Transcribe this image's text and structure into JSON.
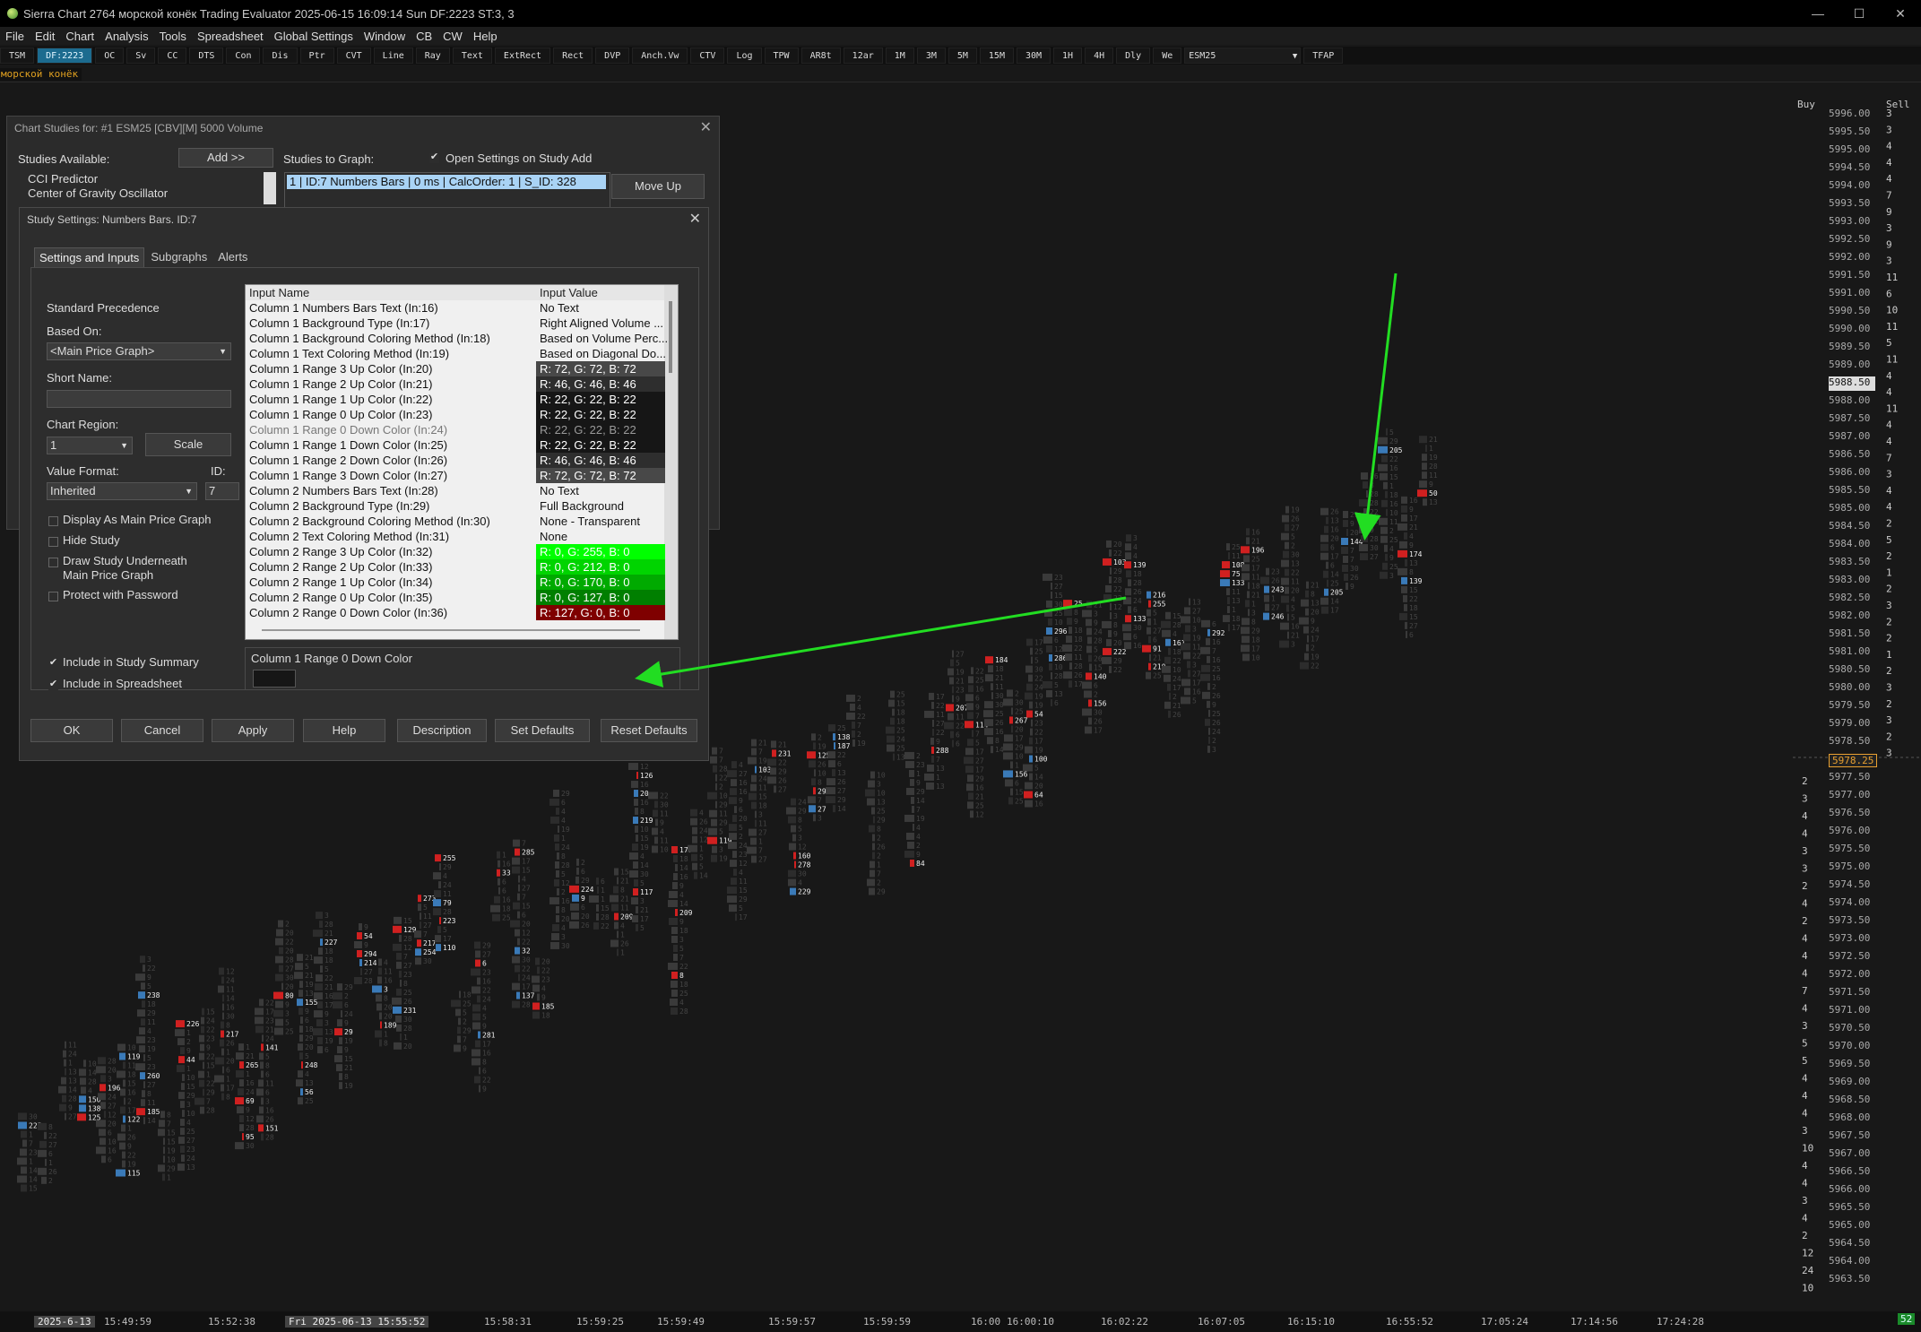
{
  "window": {
    "title": "Sierra Chart 2764 морской конёк Trading Evaluator 2025-06-15  16:09:14 Sun DF:2223  ST:3, 3",
    "controls": [
      "—",
      "☐",
      "✕"
    ]
  },
  "menu": [
    "File",
    "Edit",
    "Chart",
    "Analysis",
    "Tools",
    "Spreadsheet",
    "Global Settings",
    "Window",
    "CB",
    "CW",
    "Help"
  ],
  "toolbar": {
    "buttons": [
      "TSM",
      "DF:2223",
      "OC",
      "Sv",
      "CC",
      "DTS",
      "Con",
      "Dis",
      "Ptr",
      "CVT",
      "Line",
      "Ray",
      "Text",
      "ExtRect",
      "Rect",
      "DVP",
      "Anch.Vw",
      "CTV",
      "Log",
      "TPW",
      "AR8t",
      "12ar",
      "1M",
      "3M",
      "5M",
      "15M",
      "30M",
      "1H",
      "4H",
      "Dly",
      "We"
    ],
    "active_index": 1,
    "symbol": "ESM25",
    "after_symbol": "TFAP"
  },
  "chart_name": "морской конёк",
  "price_axis": {
    "header_buy": "Buy",
    "header_sell": "Sell",
    "prices": [
      "5996.00",
      "5995.50",
      "5995.00",
      "5994.50",
      "5994.00",
      "5993.50",
      "5993.00",
      "5992.50",
      "5992.00",
      "5991.50",
      "5991.00",
      "5990.50",
      "5990.00",
      "5989.50",
      "5989.00",
      "5988.50",
      "5988.00",
      "5987.50",
      "5987.00",
      "5986.50",
      "5986.00",
      "5985.50",
      "5985.00",
      "5984.50",
      "5984.00",
      "5983.50",
      "5983.00",
      "5982.50",
      "5982.00",
      "5981.50",
      "5981.00",
      "5980.50",
      "5980.00",
      "5979.50",
      "5979.00",
      "5978.50",
      "5978.00",
      "5977.50",
      "5977.00",
      "5976.50",
      "5976.00",
      "5975.50",
      "5975.00",
      "5974.50",
      "5974.00",
      "5973.50",
      "5973.00",
      "5972.50",
      "5972.00",
      "5971.50",
      "5971.00",
      "5970.50",
      "5970.00",
      "5969.50",
      "5969.00",
      "5968.50",
      "5968.00",
      "5967.50",
      "5967.00",
      "5966.50",
      "5966.00",
      "5965.50",
      "5965.00",
      "5964.50",
      "5964.00",
      "5963.50"
    ],
    "highlight_price": "5988.50",
    "current_price": "5978.25",
    "sell_column": [
      "3",
      "3",
      "4",
      "4",
      "4",
      "7",
      "9",
      "3",
      "9",
      "3",
      "11",
      "6",
      "10",
      "11",
      "5",
      "11",
      "4",
      "4",
      "11",
      "4",
      "4",
      "7",
      "3",
      "4",
      "4",
      "2",
      "5",
      "2",
      "1",
      "2",
      "3",
      "2",
      "2",
      "1",
      "2",
      "3",
      "2",
      "3",
      "2",
      "3"
    ],
    "buy_column": [
      "2",
      "3",
      "4",
      "4",
      "3",
      "3",
      "2",
      "4",
      "2",
      "4",
      "4",
      "4",
      "7",
      "4",
      "3",
      "5",
      "5",
      "4",
      "4",
      "4",
      "3",
      "10",
      "4",
      "4",
      "3",
      "4",
      "2",
      "12",
      "24",
      "10"
    ],
    "bottom_badge": "52"
  },
  "time_axis": {
    "labels": [
      "2025-6-13",
      "15:49:59",
      "15:52:38",
      "Fri 2025-06-13  15:55:52",
      "15:58:31",
      "15:59:25",
      "15:59:49",
      "15:59:57",
      "15:59:59",
      "16:00",
      "16:00:10",
      "16:02:22",
      "16:07:05",
      "16:15:10",
      "16:55:52",
      "17:05:24",
      "17:14:56",
      "17:24:28"
    ]
  },
  "chart_studies_dialog": {
    "title": "Chart Studies for: #1 ESM25 [CBV][M]  5000 Volume",
    "studies_available_label": "Studies Available:",
    "add_button": "Add >>",
    "studies_available": [
      "CCI Predictor",
      "Center of Gravity Oscillator"
    ],
    "studies_to_graph_label": "Studies to Graph:",
    "open_settings_checkbox": "Open Settings on Study Add",
    "selected_study": "1 | ID:7  Numbers Bars | 0 ms | CalcOrder: 1 | S_ID: 328",
    "move_up_button": "Move Up"
  },
  "study_settings_dialog": {
    "title": "Study Settings: Numbers Bars. ID:7",
    "tabs": [
      "Settings and Inputs",
      "Subgraphs",
      "Alerts"
    ],
    "standard_precedence": "Standard Precedence",
    "based_on_label": "Based On:",
    "based_on_value": "<Main Price Graph>",
    "short_name_label": "Short Name:",
    "short_name_value": "",
    "chart_region_label": "Chart Region:",
    "chart_region_value": "1",
    "scale_button": "Scale",
    "value_format_label": "Value Format:",
    "value_format_value": "Inherited",
    "id_label": "ID:",
    "id_value": "7",
    "checkboxes": [
      {
        "label": "Display As Main Price Graph",
        "checked": false
      },
      {
        "label": "Hide Study",
        "checked": false
      },
      {
        "label": "Draw Study Underneath",
        "label2": "Main Price Graph",
        "checked": false
      },
      {
        "label": "Protect with Password",
        "checked": false
      }
    ],
    "summary_checkboxes": [
      {
        "label": "Include in Study Summary",
        "checked": true
      },
      {
        "label": "Include in Spreadsheet",
        "checked": true
      }
    ],
    "grid_headers": [
      "Input Name",
      "Input Value"
    ],
    "inputs": [
      {
        "name": "Column 1 Numbers Bars Text  (In:16)",
        "value": "No Text",
        "bg": "",
        "fg": "#111"
      },
      {
        "name": "Column 1 Background Type  (In:17)",
        "value": "Right Aligned Volume ...",
        "bg": "",
        "fg": "#111"
      },
      {
        "name": "Column 1 Background Coloring Method  (In:18)",
        "value": "Based on Volume Perc...",
        "bg": "",
        "fg": "#111"
      },
      {
        "name": "Column 1 Text Coloring Method  (In:19)",
        "value": "Based on Diagonal Do...",
        "bg": "",
        "fg": "#111"
      },
      {
        "name": "Column 1 Range 3 Up Color  (In:20)",
        "value": "R: 72, G: 72, B: 72",
        "bg": "#484848",
        "fg": "#ffffff"
      },
      {
        "name": "Column 1 Range 2 Up Color  (In:21)",
        "value": "R: 46, G: 46, B: 46",
        "bg": "#2e2e2e",
        "fg": "#ffffff"
      },
      {
        "name": "Column 1 Range 1 Up Color  (In:22)",
        "value": "R: 22, G: 22, B: 22",
        "bg": "#161616",
        "fg": "#ffffff"
      },
      {
        "name": "Column 1 Range 0 Up Color  (In:23)",
        "value": "R: 22, G: 22, B: 22",
        "bg": "#161616",
        "fg": "#ffffff"
      },
      {
        "name": "Column 1 Range 0 Down Color  (In:24)",
        "value": "R: 22, G: 22, B: 22",
        "bg": "#161616",
        "fg": "#9a9a9a",
        "selected": true
      },
      {
        "name": "Column 1 Range 1 Down Color  (In:25)",
        "value": "R: 22, G: 22, B: 22",
        "bg": "#161616",
        "fg": "#ffffff"
      },
      {
        "name": "Column 1 Range 2 Down Color  (In:26)",
        "value": "R: 46, G: 46, B: 46",
        "bg": "#2e2e2e",
        "fg": "#ffffff"
      },
      {
        "name": "Column 1 Range 3 Down Color  (In:27)",
        "value": "R: 72, G: 72, B: 72",
        "bg": "#484848",
        "fg": "#ffffff"
      },
      {
        "name": "Column 2 Numbers Bars Text  (In:28)",
        "value": "No Text",
        "bg": "",
        "fg": "#111"
      },
      {
        "name": "Column 2 Background Type  (In:29)",
        "value": "Full Background",
        "bg": "",
        "fg": "#111"
      },
      {
        "name": "Column 2 Background Coloring Method  (In:30)",
        "value": "None - Transparent",
        "bg": "",
        "fg": "#111"
      },
      {
        "name": "Column 2 Text Coloring Method  (In:31)",
        "value": "None",
        "bg": "",
        "fg": "#111"
      },
      {
        "name": "Column 2 Range 3 Up Color  (In:32)",
        "value": "R: 0, G: 255, B: 0",
        "bg": "#00ff00",
        "fg": "#ffffff"
      },
      {
        "name": "Column 2 Range 2 Up Color  (In:33)",
        "value": "R: 0, G: 212, B: 0",
        "bg": "#00d400",
        "fg": "#ffffff"
      },
      {
        "name": "Column 2 Range 1 Up Color  (In:34)",
        "value": "R: 0, G: 170, B: 0",
        "bg": "#00aa00",
        "fg": "#ffffff"
      },
      {
        "name": "Column 2 Range 0 Up Color  (In:35)",
        "value": "R: 0, G: 127, B: 0",
        "bg": "#007f00",
        "fg": "#ffffff"
      },
      {
        "name": "Column 2 Range 0 Down Color  (In:36)",
        "value": "R: 127, G: 0, B: 0",
        "bg": "#7f0000",
        "fg": "#ffffff"
      }
    ],
    "selected_input_label": "Column 1 Range 0 Down Color",
    "selected_input_swatch": "#161616",
    "buttons": [
      "OK",
      "Cancel",
      "Apply",
      "Help",
      "Description",
      "Set Defaults",
      "Reset Defaults"
    ]
  },
  "annotation_color": "#22dd22"
}
